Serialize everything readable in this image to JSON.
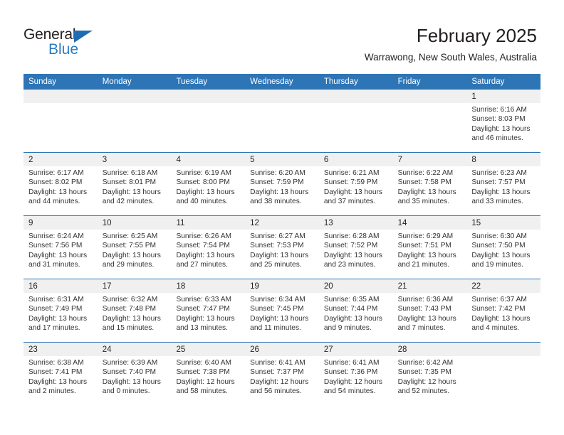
{
  "brand": {
    "name_top": "General",
    "name_bottom": "Blue",
    "accent_color": "#2b7cc4",
    "triangle_color": "#1f6cb4"
  },
  "header": {
    "month_title": "February 2025",
    "location": "Warrawong, New South Wales, Australia",
    "header_bg_color": "#2e75b6"
  },
  "weekdays": [
    "Sunday",
    "Monday",
    "Tuesday",
    "Wednesday",
    "Thursday",
    "Friday",
    "Saturday"
  ],
  "weeks": [
    [
      {
        "day": "",
        "sunrise": "",
        "sunset": "",
        "daylight": "",
        "empty": true
      },
      {
        "day": "",
        "sunrise": "",
        "sunset": "",
        "daylight": "",
        "empty": true
      },
      {
        "day": "",
        "sunrise": "",
        "sunset": "",
        "daylight": "",
        "empty": true
      },
      {
        "day": "",
        "sunrise": "",
        "sunset": "",
        "daylight": "",
        "empty": true
      },
      {
        "day": "",
        "sunrise": "",
        "sunset": "",
        "daylight": "",
        "empty": true
      },
      {
        "day": "",
        "sunrise": "",
        "sunset": "",
        "daylight": "",
        "empty": true
      },
      {
        "day": "1",
        "sunrise": "Sunrise: 6:16 AM",
        "sunset": "Sunset: 8:03 PM",
        "daylight": "Daylight: 13 hours and 46 minutes."
      }
    ],
    [
      {
        "day": "2",
        "sunrise": "Sunrise: 6:17 AM",
        "sunset": "Sunset: 8:02 PM",
        "daylight": "Daylight: 13 hours and 44 minutes."
      },
      {
        "day": "3",
        "sunrise": "Sunrise: 6:18 AM",
        "sunset": "Sunset: 8:01 PM",
        "daylight": "Daylight: 13 hours and 42 minutes."
      },
      {
        "day": "4",
        "sunrise": "Sunrise: 6:19 AM",
        "sunset": "Sunset: 8:00 PM",
        "daylight": "Daylight: 13 hours and 40 minutes."
      },
      {
        "day": "5",
        "sunrise": "Sunrise: 6:20 AM",
        "sunset": "Sunset: 7:59 PM",
        "daylight": "Daylight: 13 hours and 38 minutes."
      },
      {
        "day": "6",
        "sunrise": "Sunrise: 6:21 AM",
        "sunset": "Sunset: 7:59 PM",
        "daylight": "Daylight: 13 hours and 37 minutes."
      },
      {
        "day": "7",
        "sunrise": "Sunrise: 6:22 AM",
        "sunset": "Sunset: 7:58 PM",
        "daylight": "Daylight: 13 hours and 35 minutes."
      },
      {
        "day": "8",
        "sunrise": "Sunrise: 6:23 AM",
        "sunset": "Sunset: 7:57 PM",
        "daylight": "Daylight: 13 hours and 33 minutes."
      }
    ],
    [
      {
        "day": "9",
        "sunrise": "Sunrise: 6:24 AM",
        "sunset": "Sunset: 7:56 PM",
        "daylight": "Daylight: 13 hours and 31 minutes."
      },
      {
        "day": "10",
        "sunrise": "Sunrise: 6:25 AM",
        "sunset": "Sunset: 7:55 PM",
        "daylight": "Daylight: 13 hours and 29 minutes."
      },
      {
        "day": "11",
        "sunrise": "Sunrise: 6:26 AM",
        "sunset": "Sunset: 7:54 PM",
        "daylight": "Daylight: 13 hours and 27 minutes."
      },
      {
        "day": "12",
        "sunrise": "Sunrise: 6:27 AM",
        "sunset": "Sunset: 7:53 PM",
        "daylight": "Daylight: 13 hours and 25 minutes."
      },
      {
        "day": "13",
        "sunrise": "Sunrise: 6:28 AM",
        "sunset": "Sunset: 7:52 PM",
        "daylight": "Daylight: 13 hours and 23 minutes."
      },
      {
        "day": "14",
        "sunrise": "Sunrise: 6:29 AM",
        "sunset": "Sunset: 7:51 PM",
        "daylight": "Daylight: 13 hours and 21 minutes."
      },
      {
        "day": "15",
        "sunrise": "Sunrise: 6:30 AM",
        "sunset": "Sunset: 7:50 PM",
        "daylight": "Daylight: 13 hours and 19 minutes."
      }
    ],
    [
      {
        "day": "16",
        "sunrise": "Sunrise: 6:31 AM",
        "sunset": "Sunset: 7:49 PM",
        "daylight": "Daylight: 13 hours and 17 minutes."
      },
      {
        "day": "17",
        "sunrise": "Sunrise: 6:32 AM",
        "sunset": "Sunset: 7:48 PM",
        "daylight": "Daylight: 13 hours and 15 minutes."
      },
      {
        "day": "18",
        "sunrise": "Sunrise: 6:33 AM",
        "sunset": "Sunset: 7:47 PM",
        "daylight": "Daylight: 13 hours and 13 minutes."
      },
      {
        "day": "19",
        "sunrise": "Sunrise: 6:34 AM",
        "sunset": "Sunset: 7:45 PM",
        "daylight": "Daylight: 13 hours and 11 minutes."
      },
      {
        "day": "20",
        "sunrise": "Sunrise: 6:35 AM",
        "sunset": "Sunset: 7:44 PM",
        "daylight": "Daylight: 13 hours and 9 minutes."
      },
      {
        "day": "21",
        "sunrise": "Sunrise: 6:36 AM",
        "sunset": "Sunset: 7:43 PM",
        "daylight": "Daylight: 13 hours and 7 minutes."
      },
      {
        "day": "22",
        "sunrise": "Sunrise: 6:37 AM",
        "sunset": "Sunset: 7:42 PM",
        "daylight": "Daylight: 13 hours and 4 minutes."
      }
    ],
    [
      {
        "day": "23",
        "sunrise": "Sunrise: 6:38 AM",
        "sunset": "Sunset: 7:41 PM",
        "daylight": "Daylight: 13 hours and 2 minutes."
      },
      {
        "day": "24",
        "sunrise": "Sunrise: 6:39 AM",
        "sunset": "Sunset: 7:40 PM",
        "daylight": "Daylight: 13 hours and 0 minutes."
      },
      {
        "day": "25",
        "sunrise": "Sunrise: 6:40 AM",
        "sunset": "Sunset: 7:38 PM",
        "daylight": "Daylight: 12 hours and 58 minutes."
      },
      {
        "day": "26",
        "sunrise": "Sunrise: 6:41 AM",
        "sunset": "Sunset: 7:37 PM",
        "daylight": "Daylight: 12 hours and 56 minutes."
      },
      {
        "day": "27",
        "sunrise": "Sunrise: 6:41 AM",
        "sunset": "Sunset: 7:36 PM",
        "daylight": "Daylight: 12 hours and 54 minutes."
      },
      {
        "day": "28",
        "sunrise": "Sunrise: 6:42 AM",
        "sunset": "Sunset: 7:35 PM",
        "daylight": "Daylight: 12 hours and 52 minutes."
      },
      {
        "day": "",
        "sunrise": "",
        "sunset": "",
        "daylight": "",
        "empty": true
      }
    ]
  ]
}
